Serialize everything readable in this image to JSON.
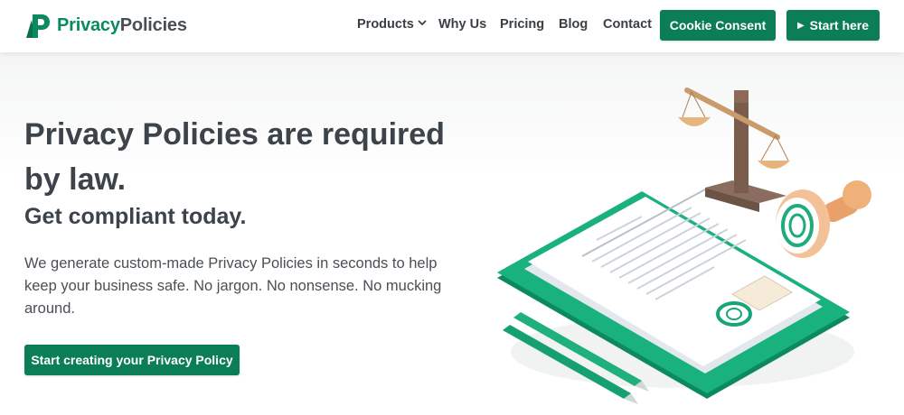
{
  "header": {
    "logo_text_1": "Privacy",
    "logo_text_2": "Policies",
    "nav": {
      "products": "Products",
      "why_us": "Why Us",
      "pricing": "Pricing",
      "blog": "Blog",
      "contact": "Contact"
    },
    "cookie_consent_label": "Cookie Consent",
    "start_here_label": "Start here"
  },
  "hero": {
    "headline": "Privacy Policies are required by law.",
    "subheadline": "Get compliant today.",
    "description": "We generate custom-made Privacy Policies in seconds to help keep your business safe. No jargon. No nonsense. No mucking around.",
    "cta_label": "Start creating your Privacy Policy"
  },
  "colors": {
    "brand_green": "#0b7d57",
    "text_dark": "#3d434a"
  },
  "icons": [
    "logo-icon",
    "chevron-down-icon",
    "play-icon",
    "legal-documents-illustration"
  ]
}
